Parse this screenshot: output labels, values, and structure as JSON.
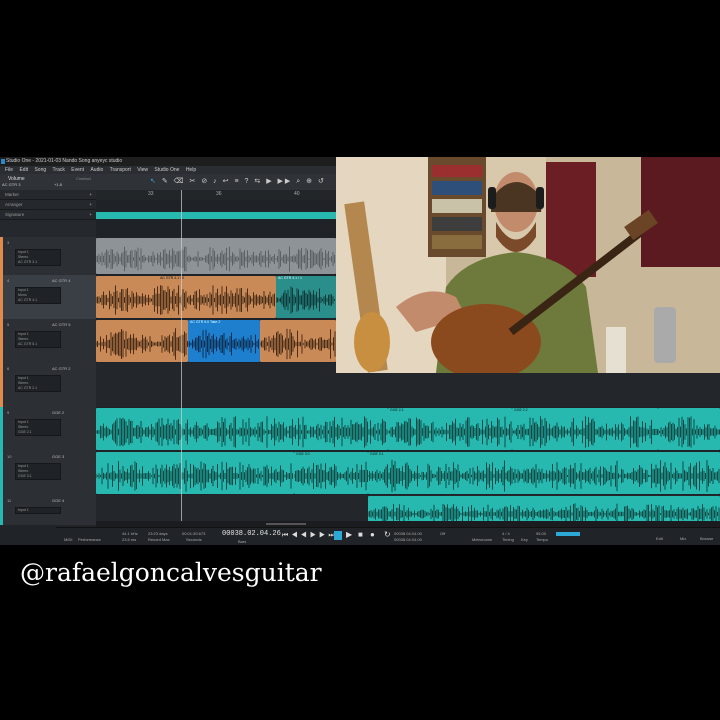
{
  "window": {
    "title": "Studio One - 2021-01-03 Nando Song anyeyc studio",
    "menu": [
      "File",
      "Edit",
      "Song",
      "Track",
      "Event",
      "Audio",
      "Transport",
      "View",
      "Studio One",
      "Help"
    ]
  },
  "toolbar": {
    "volume_label": "Volume",
    "track_name": "AC GTR 3",
    "db_value": "+1.8",
    "control_label": "Cinefact",
    "tools": [
      "↖",
      "✎",
      "⌫",
      "✂",
      "⊘",
      "♪",
      "↩",
      "≡",
      "?",
      "⇆",
      "▶",
      "▶▶",
      "⌕",
      "⊕",
      "↺"
    ]
  },
  "ruler": {
    "marks": [
      "33",
      "36",
      "40"
    ]
  },
  "global_tracks": [
    {
      "label": "Marker"
    },
    {
      "label": "Arranger"
    },
    {
      "label": "Signature"
    }
  ],
  "tracks": [
    {
      "num": "3",
      "name": "",
      "io": [
        "Input 1",
        "Stereo",
        "AC GTR 3.1"
      ],
      "color": "#e08a4c"
    },
    {
      "num": "4",
      "name": "AC GTR 4",
      "io": [
        "Input 1",
        "Mono",
        "AC GTR 4.1"
      ],
      "color": "#e08a4c"
    },
    {
      "num": "5",
      "name": "AC GTR 5",
      "io": [
        "Input 1",
        "Stereo",
        "AC GTR 5.1"
      ],
      "color": "#e08a4c"
    },
    {
      "num": "6",
      "name": "AC GTR 2",
      "io": [
        "Input 1",
        "Stereo",
        "AC GTR 2.1"
      ],
      "color": "#e08a4c"
    },
    {
      "num": "9",
      "name": "GGE 2",
      "io": [
        "Input 1",
        "Stereo",
        "GGE 2.1"
      ],
      "color": "#27b9b0"
    },
    {
      "num": "10",
      "name": "GGE 3",
      "io": [
        "Input 1",
        "Stereo",
        "GGE 3.1"
      ],
      "color": "#27b9b0"
    },
    {
      "num": "11",
      "name": "GGE 4",
      "io": [
        "Input 1",
        "Stereo",
        "GGE 4.1"
      ],
      "color": "#27b9b0"
    }
  ],
  "clips": {
    "t4a": "AC GTR 4.1 / 0",
    "t4b": "AC GTR 4.1 / 1",
    "t5": "AC GTR 5.0 Take 2",
    "t9a": "GGE 2.1",
    "t9b": "GGE 2.2",
    "t10a": "GGE 3.0",
    "t10b": "GGE 3.1"
  },
  "transport": {
    "sample_rate": "44.1 kHz",
    "latency": "23.5 ms",
    "record_time": "23:23 days",
    "record_max": "Record Max",
    "seconds_time": "00:01:39.673",
    "seconds_label": "Seconds",
    "bars_time": "00038.02.04.26",
    "bars_label": "Bars",
    "loop_l": "00038.04.04.00",
    "loop_r": "00038.04.04.00",
    "metronome": "Metronome",
    "sync": "Off",
    "timing": "Timing",
    "signature": "4 / 4",
    "key": "Key",
    "tempo": "95.00",
    "tempo_label": "Tempo",
    "views": [
      "Edit",
      "Mix",
      "Browse"
    ],
    "perf": "Performance",
    "midi": "MIDI"
  },
  "footer": {
    "zoom_label": "Medium"
  },
  "overlay": {
    "handle": "@rafaelgoncalvesguitar"
  },
  "colors": {
    "orange_clip": "#c98a57",
    "teal_clip": "#27b9b0",
    "gray_clip": "#8e9398",
    "blue_clip": "#1f7fcf"
  }
}
